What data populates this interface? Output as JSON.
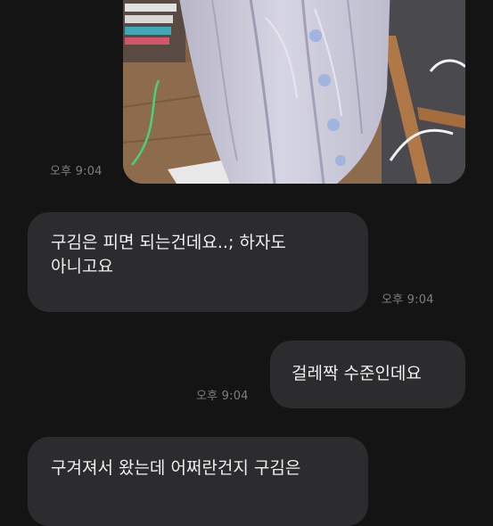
{
  "messages": [
    {
      "type": "image",
      "side": "sent",
      "time": "오후 9:04"
    },
    {
      "type": "text",
      "side": "received",
      "lines": [
        "구김은 피면 되는건데요..; 하자도",
        "아니고요"
      ],
      "time": "오후 9:04"
    },
    {
      "type": "text",
      "side": "sent",
      "lines": [
        "걸레짝 수준인데요"
      ],
      "time": "오후 9:04"
    },
    {
      "type": "text",
      "side": "received",
      "lines": [
        "구겨져서 왔는데 어쩌란건지 구김은"
      ]
    }
  ]
}
